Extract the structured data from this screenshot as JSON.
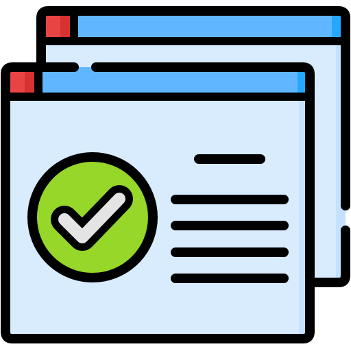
{
  "icon": {
    "name": "verified-browser-windows-icon",
    "colors": {
      "outline": "#000000",
      "window_body": "#d8ecfe",
      "window_body_shade": "#c4e2ff",
      "title_bar": "#60b7ff",
      "title_bar_shade": "#26a6fe",
      "close_button": "#e94444",
      "close_button_shade": "#d83131",
      "check_circle": "#97d729",
      "check_circle_shade": "#7ed00f",
      "check_mark": "#e4e4e4",
      "check_mark_shade": "#d3d3d3"
    }
  }
}
